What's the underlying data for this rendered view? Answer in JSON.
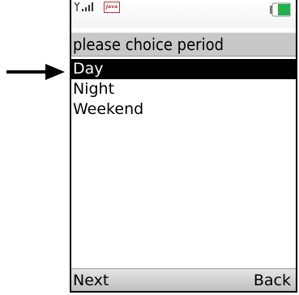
{
  "status_bar": {
    "signal_icon": "signal-strength-icon",
    "java_icon": "java-icon",
    "battery_icon": "battery-icon",
    "battery_color": "#22b14c"
  },
  "screen": {
    "title": "please choice period",
    "items": [
      {
        "label": "Day",
        "selected": true
      },
      {
        "label": "Night",
        "selected": false
      },
      {
        "label": "Weekend",
        "selected": false
      }
    ]
  },
  "softkeys": {
    "left": "Next",
    "right": "Back"
  },
  "pointer": {
    "icon": "arrow-right-icon"
  }
}
